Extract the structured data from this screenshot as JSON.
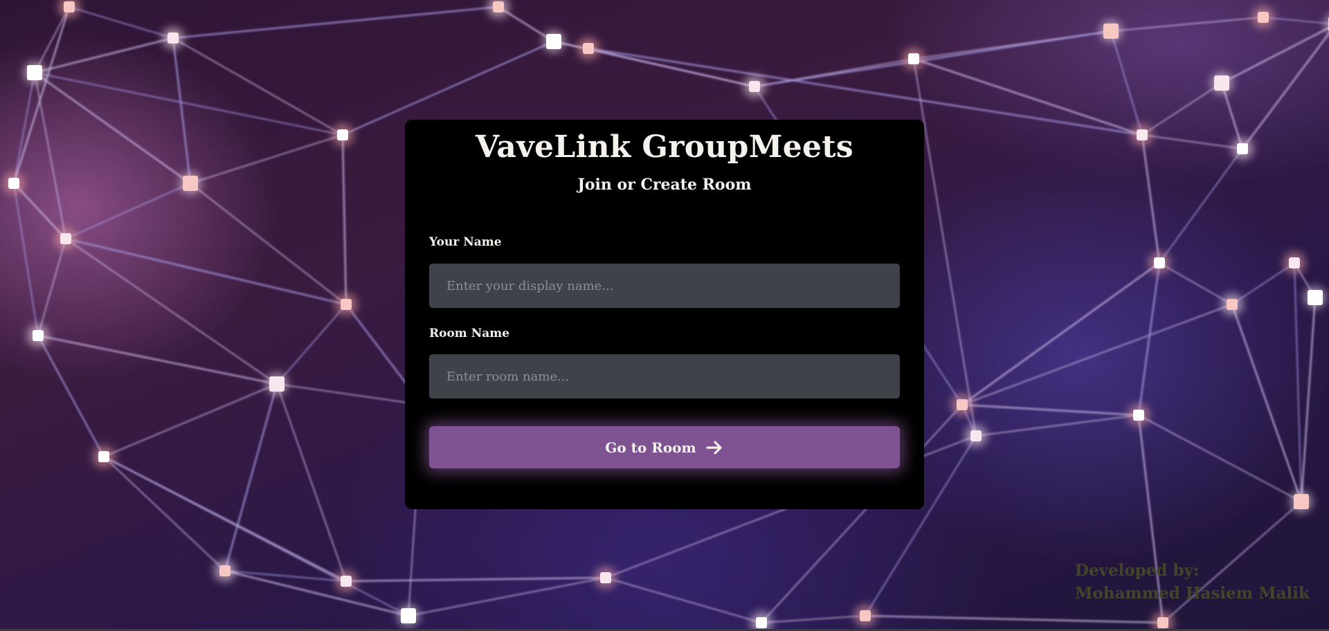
{
  "app": {
    "title": "VaveLink GroupMeets",
    "subtitle": "Join or Create Room"
  },
  "form": {
    "name_label": "Your Name",
    "name_placeholder": "Enter your display name...",
    "name_value": "",
    "room_label": "Room Name",
    "room_placeholder": "Enter room name...",
    "room_value": "",
    "submit_label": "Go to Room",
    "submit_icon": "arrow-right-icon"
  },
  "footer": {
    "credit_line1": "Developed by:",
    "credit_line2": "Mohammed Hasiem Malik"
  },
  "colors": {
    "card_background": "#000000",
    "input_background": "#3f4349",
    "button_background": "#7f5391",
    "text_primary": "#f5f2ee",
    "credit_text": "#44442a"
  }
}
